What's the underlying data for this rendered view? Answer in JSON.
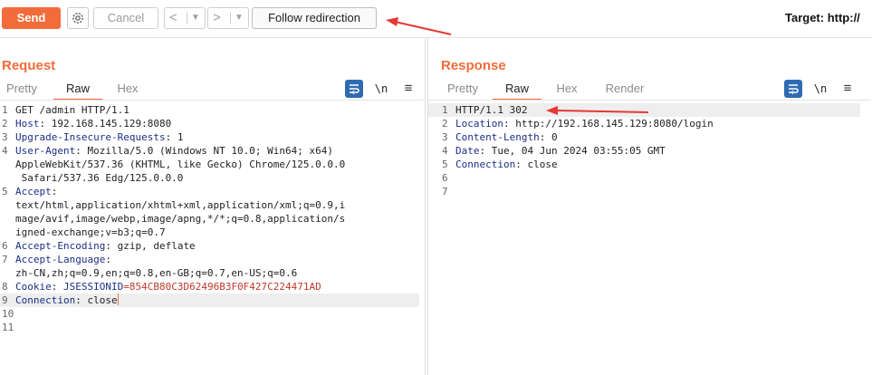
{
  "toolbar": {
    "send_label": "Send",
    "settings_icon": "gear-icon",
    "cancel_label": "Cancel",
    "back_icon": "<",
    "forward_icon": ">",
    "dropdown_icon": "▼",
    "follow_label": "Follow redirection",
    "target_label": "Target: http://"
  },
  "colors": {
    "accent": "#f26b3a",
    "blue": "#2f6bb3",
    "header_name": "#1c2f86",
    "cookie_value": "#c0392b",
    "annotation": "#e53935"
  },
  "request": {
    "title": "Request",
    "tabs": [
      "Pretty",
      "Raw",
      "Hex"
    ],
    "active_tab": "Raw",
    "lines": [
      {
        "n": "1",
        "text": "GET /admin HTTP/1.1"
      },
      {
        "n": "2",
        "name": "Host",
        "value": " 192.168.145.129:8080"
      },
      {
        "n": "3",
        "name": "Upgrade-Insecure-Requests",
        "value": " 1"
      },
      {
        "n": "4",
        "name": "User-Agent",
        "value": " Mozilla/5.0 (Windows NT 10.0; Win64; x64)"
      },
      {
        "n": "",
        "text": "AppleWebKit/537.36 (KHTML, like Gecko) Chrome/125.0.0.0"
      },
      {
        "n": "",
        "text": " Safari/537.36 Edg/125.0.0.0"
      },
      {
        "n": "5",
        "name": "Accept",
        "value": ""
      },
      {
        "n": "",
        "text": "text/html,application/xhtml+xml,application/xml;q=0.9,i"
      },
      {
        "n": "",
        "text": "mage/avif,image/webp,image/apng,*/*;q=0.8,application/s"
      },
      {
        "n": "",
        "text": "igned-exchange;v=b3;q=0.7"
      },
      {
        "n": "6",
        "name": "Accept-Encoding",
        "value": " gzip, deflate"
      },
      {
        "n": "7",
        "name": "Accept-Language",
        "value": ""
      },
      {
        "n": "",
        "text": "zh-CN,zh;q=0.9,en;q=0.8,en-GB;q=0.7,en-US;q=0.6"
      },
      {
        "n": "8",
        "name": "Cookie",
        "value": " ",
        "cookie_key": "JSESSIONID",
        "cookie_value": "=854CB80C3D62496B3F0F427C224471AD"
      },
      {
        "n": "9",
        "name": "Connection",
        "value": " close",
        "highlight": true,
        "caret": true
      },
      {
        "n": "10",
        "text": ""
      },
      {
        "n": "11",
        "text": ""
      }
    ]
  },
  "response": {
    "title": "Response",
    "tabs": [
      "Pretty",
      "Raw",
      "Hex",
      "Render"
    ],
    "active_tab": "Raw",
    "lines": [
      {
        "n": "1",
        "text": "HTTP/1.1 302",
        "highlight": true
      },
      {
        "n": "2",
        "name": "Location",
        "value": " http://192.168.145.129:8080/login"
      },
      {
        "n": "3",
        "name": "Content-Length",
        "value": " 0"
      },
      {
        "n": "4",
        "name": "Date",
        "value": " Tue, 04 Jun 2024 03:55:05 GMT"
      },
      {
        "n": "5",
        "name": "Connection",
        "value": " close"
      },
      {
        "n": "6",
        "text": ""
      },
      {
        "n": "7",
        "text": ""
      }
    ]
  },
  "editor_tools": {
    "wrap_icon": "word-wrap-icon",
    "newline_label": "\\n",
    "menu_icon": "≡"
  },
  "view_toggle": [
    "side-by-side",
    "stacked",
    "single"
  ]
}
